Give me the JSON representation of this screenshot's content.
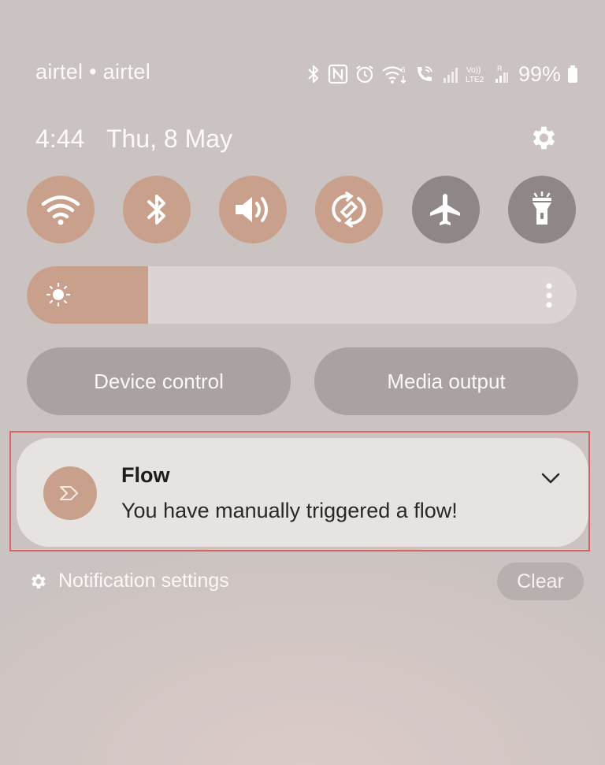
{
  "status_bar": {
    "carrier": "airtel • airtel",
    "network_label": "LTE2",
    "volte_label": "Vo))",
    "roaming_label": "R",
    "wifi_calling_label": "6",
    "battery": "99%",
    "icons": [
      "bluetooth-icon",
      "nfc-icon",
      "alarm-icon",
      "wifi-icon",
      "wifi-calling-icon",
      "signal-icon",
      "volte-icon",
      "signal-roaming-icon",
      "battery-icon"
    ]
  },
  "header": {
    "time": "4:44",
    "date": "Thu, 8 May",
    "settings_icon": "gear-icon"
  },
  "quick_tiles": [
    {
      "name": "wifi",
      "icon": "wifi-icon",
      "state": "on"
    },
    {
      "name": "bluetooth",
      "icon": "bluetooth-icon",
      "state": "on"
    },
    {
      "name": "sound",
      "icon": "volume-icon",
      "state": "on"
    },
    {
      "name": "auto-rotate",
      "icon": "rotate-icon",
      "state": "on"
    },
    {
      "name": "airplane-mode",
      "icon": "airplane-icon",
      "state": "off"
    },
    {
      "name": "flashlight",
      "icon": "flashlight-icon",
      "state": "off"
    }
  ],
  "brightness": {
    "level": 0.22,
    "icon": "sun-icon",
    "more_icon": "more-vertical-icon"
  },
  "buttons": {
    "device_control": "Device control",
    "media_output": "Media output"
  },
  "notification": {
    "app": "Flow",
    "message": "You have manually triggered a flow!",
    "icon": "power-automate-icon"
  },
  "footer": {
    "settings_label": "Notification settings",
    "clear_label": "Clear"
  },
  "colors": {
    "accent": "#c9a08c",
    "tile_off": "#8f8786",
    "background": "#cbc3c1",
    "highlight": "#d8645f"
  }
}
